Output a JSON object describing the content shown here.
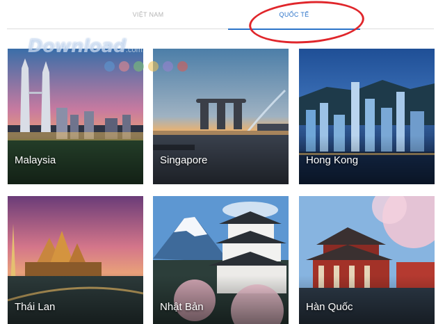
{
  "tabs": [
    {
      "label": "VIỆT NAM",
      "active": false
    },
    {
      "label": "QUỐC TẾ",
      "active": true
    }
  ],
  "watermark": {
    "text": "Download",
    "suffix": ".com.vn"
  },
  "colors": {
    "accent": "#2b73c9",
    "annotation": "#e0262b",
    "inactive_tab": "#b5b5b5"
  },
  "destinations": [
    {
      "name": "Malaysia"
    },
    {
      "name": "Singapore"
    },
    {
      "name": "Hong Kong"
    },
    {
      "name": "Thái Lan"
    },
    {
      "name": "Nhật Bản"
    },
    {
      "name": "Hàn Quốc"
    }
  ]
}
